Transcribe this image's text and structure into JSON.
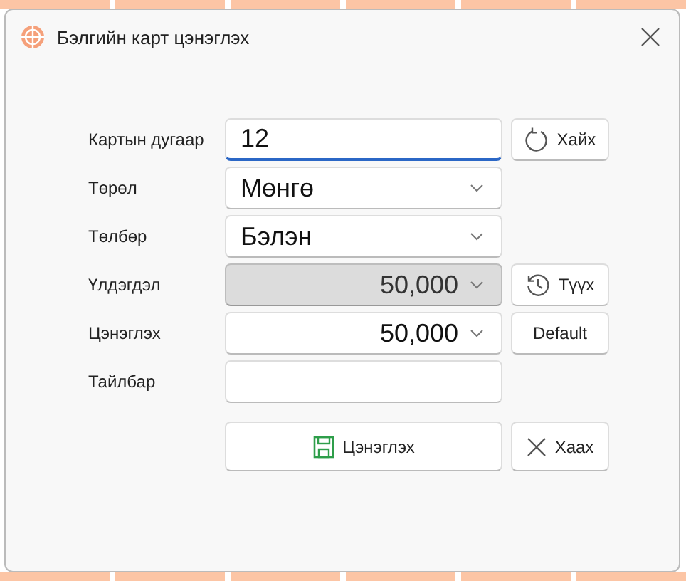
{
  "window": {
    "title": "Бэлгийн карт цэнэглэх"
  },
  "fields": [
    {
      "kind": "input",
      "label": "Картын дугаар",
      "value": "12",
      "focused": true,
      "disabled": false,
      "button": {
        "kind": "refresh",
        "label": "Хайх"
      }
    },
    {
      "kind": "select",
      "label": "Төрөл",
      "value": "Мөнгө",
      "focused": false,
      "disabled": false
    },
    {
      "kind": "select",
      "label": "Төлбөр",
      "value": "Бэлэн",
      "focused": false,
      "disabled": false
    },
    {
      "kind": "amount",
      "label": "Үлдэгдэл",
      "value": "50,000",
      "focused": false,
      "disabled": true,
      "button": {
        "kind": "history",
        "label": "Түүх"
      }
    },
    {
      "kind": "amount",
      "label": "Цэнэглэх",
      "value": "50,000",
      "focused": false,
      "disabled": false,
      "button": {
        "kind": "text",
        "label": "Default"
      }
    },
    {
      "kind": "input",
      "label": "Тайлбар",
      "focused": false,
      "disabled": false
    }
  ],
  "buttons": [
    {
      "kind": "save",
      "label": "Цэнэглэх"
    },
    {
      "kind": "close",
      "label": "Хаах"
    }
  ]
}
